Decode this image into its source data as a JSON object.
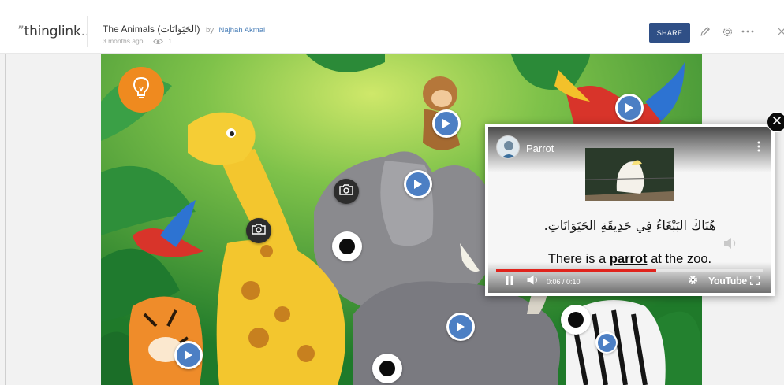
{
  "header": {
    "logo_text": "thinglink",
    "logo_dots": "..",
    "title": "The Animals (الحَيَوَانَات)",
    "by_label": "by",
    "author": "Najhah Akmal",
    "posted": "3 months ago",
    "views": "1",
    "share_label": "SHARE",
    "icons": [
      "pencil-icon",
      "settings-icon",
      "more-icon",
      "close-icon"
    ]
  },
  "canvas": {
    "theme_colors": {
      "jungle": "#2f8a2b",
      "sky": "#7fc24a",
      "accent": "#ef8a1f",
      "hotspot_blue": "#4c7fc4"
    },
    "hotspots": [
      {
        "type": "tip",
        "icon": "lightbulb-icon"
      },
      {
        "type": "video",
        "icon": "play-icon"
      },
      {
        "type": "video",
        "icon": "play-icon"
      },
      {
        "type": "video",
        "icon": "play-icon"
      },
      {
        "type": "image",
        "icon": "camera-icon"
      },
      {
        "type": "image",
        "icon": "camera-icon"
      },
      {
        "type": "text",
        "icon": "dot-icon"
      },
      {
        "type": "video",
        "icon": "play-icon"
      },
      {
        "type": "text",
        "icon": "dot-icon"
      },
      {
        "type": "video",
        "icon": "play-icon"
      },
      {
        "type": "video",
        "icon": "play-icon"
      },
      {
        "type": "text",
        "icon": "dot-icon"
      }
    ]
  },
  "video": {
    "title": "Parrot",
    "arabic_caption": "هُنَاكَ البَبْغَاءُ فِي حَدِيقَةِ الحَيَوَانَاتِ.",
    "caption_pre": "There is a",
    "caption_key": "parrot",
    "caption_post": "at the zoo.",
    "time": "0:06 / 0:10",
    "progress": 0.6,
    "brand": "YouTube"
  }
}
